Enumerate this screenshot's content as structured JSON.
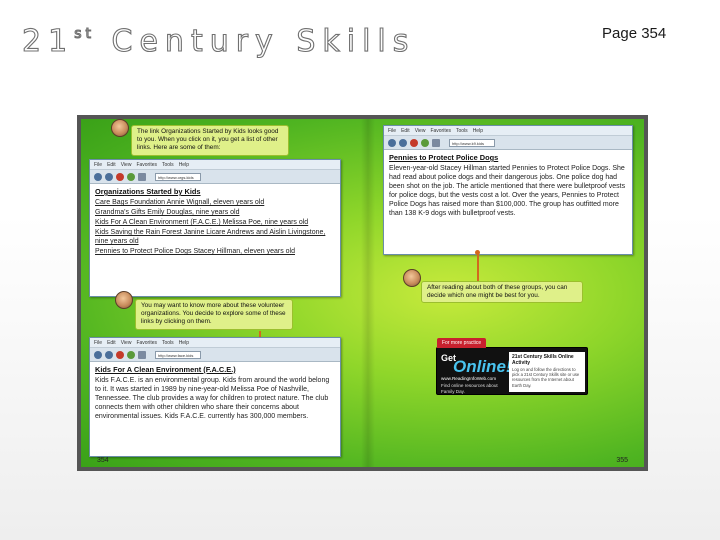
{
  "slide": {
    "title_num": "21",
    "title_sup": "st",
    "title_rest": "Century Skills",
    "page_ref": "Page 354"
  },
  "spread": {
    "left_page_number": "354",
    "right_page_number": "355",
    "callout_top": "The link Organizations Started by Kids looks good to you. When you click on it, you get a list of other links. Here are some of them:",
    "browser1": {
      "menu": [
        "File",
        "Edit",
        "View",
        "Favorites",
        "Tools",
        "Help"
      ],
      "address": "http://www.orgs.kids",
      "heading": "Organizations Started by Kids",
      "links": [
        "Care Bags Foundation Annie Wignall, eleven years old",
        "Grandma's Gifts Emily Douglas, nine years old",
        "Kids For A Clean Environment (F.A.C.E.) Melissa Poe, nine years old",
        "Kids Saving the Rain Forest Janine Licare Andrews and Aislin Livingstone, nine years old",
        "Pennies to Protect Police Dogs Stacey Hillman, eleven years old"
      ]
    },
    "callout_middle": "You may want to know more about these volunteer organizations. You decide to explore some of these links by clicking on them.",
    "browser2": {
      "menu": [
        "File",
        "Edit",
        "View",
        "Favorites",
        "Tools",
        "Help"
      ],
      "address": "http://www.face.kids",
      "heading": "Kids For A Clean Environment (F.A.C.E.)",
      "body": "Kids F.A.C.E. is an environmental group. Kids from around the world belong to it. It was started in 1989 by nine-year-old Melissa Poe of Nashville, Tennessee. The club provides a way for children to protect nature. The club connects them with other children who share their concerns about environmental issues. Kids F.A.C.E. currently has 300,000 members."
    },
    "browser3": {
      "menu": [
        "File",
        "Edit",
        "View",
        "Favorites",
        "Tools",
        "Help"
      ],
      "address": "http://www.k9.kids",
      "heading": "Pennies to Protect Police Dogs",
      "body": "Eleven-year-old Stacey Hillman started Pennies to Protect Police Dogs. She had read about police dogs and their dangerous jobs. One police dog had been shot on the job. The article mentioned that there were bulletproof vests for police dogs, but the vests cost a lot. Over the years, Pennies to Protect Police Dogs has raised more than $100,000. The group has outfitted more than 138 K-9 dogs with bulletproof vests."
    },
    "callout_right": "After reading about both of these groups, you can decide which one might be best for you.",
    "online": {
      "tab": "For more practice",
      "get": "Get",
      "word": "Online!",
      "url": "www.ReadingInfoWeb.com",
      "sub": "Find online resources about Family Day.",
      "right_title": "21st Century Skills Online Activity",
      "right_body": "Log on and follow the directions to pick a 21st Century Skills site or use resources from the Internet about Earth Day."
    }
  }
}
